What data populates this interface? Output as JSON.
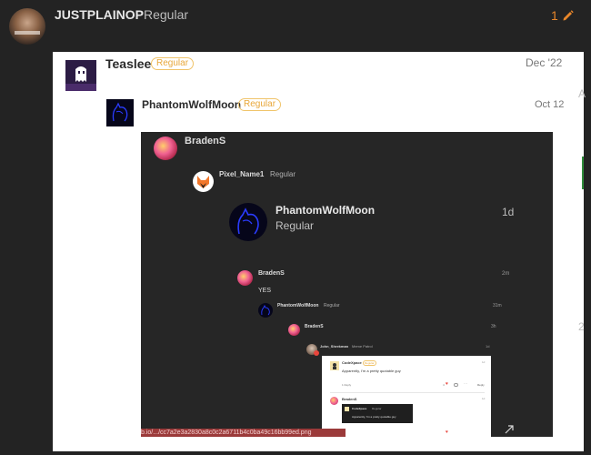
{
  "topbar": {
    "username": "JUSTPLAINOP",
    "title": "Regular",
    "edit_count": "1",
    "edit_icon": "pencil-icon",
    "accent": "#e8862a"
  },
  "quote1": {
    "username": "Teaslee",
    "badge": "Regular",
    "date": "Dec '22"
  },
  "quote2": {
    "username": "PhantomWolfMoon",
    "badge": "Regular",
    "date": "Oct 12"
  },
  "embed": {
    "top_user": "BradenS",
    "pixel_user": "Pixel_Name1",
    "pixel_title": "Regular",
    "big_user": "PhantomWolfMoon",
    "big_title": "Regular",
    "big_time": "1d",
    "b2_user": "BradenS",
    "b2_time": "2m",
    "b2_text": "YES",
    "p2_user": "PhantomWolfMoon",
    "p2_title": "Regular",
    "p2_time": "31m",
    "b3_user": "BradenS",
    "b3_time": "3h",
    "john_user": "John_Shrekman",
    "john_title": "Meme Patrol",
    "john_time": "1d",
    "inner": {
      "user": "CodeXpace",
      "badge": "Regular",
      "time": "1d",
      "text": "Apparently, I'm a pretty quotable guy",
      "replies": "1 Reply",
      "likes": "4",
      "reply_button": "Reply",
      "b_user": "BradenS",
      "b_time": "1d",
      "q_user": "CodeXpace",
      "q_title": "Regular",
      "q_text": "Apparently, I'm a pretty quotable guy"
    },
    "url_caption": "b.io/.../cc7a2e3a2830a8c0c2a6711b4c0ba49c16bb99ed.png"
  },
  "edge_markers": {
    "a": "A",
    "b": "2"
  }
}
